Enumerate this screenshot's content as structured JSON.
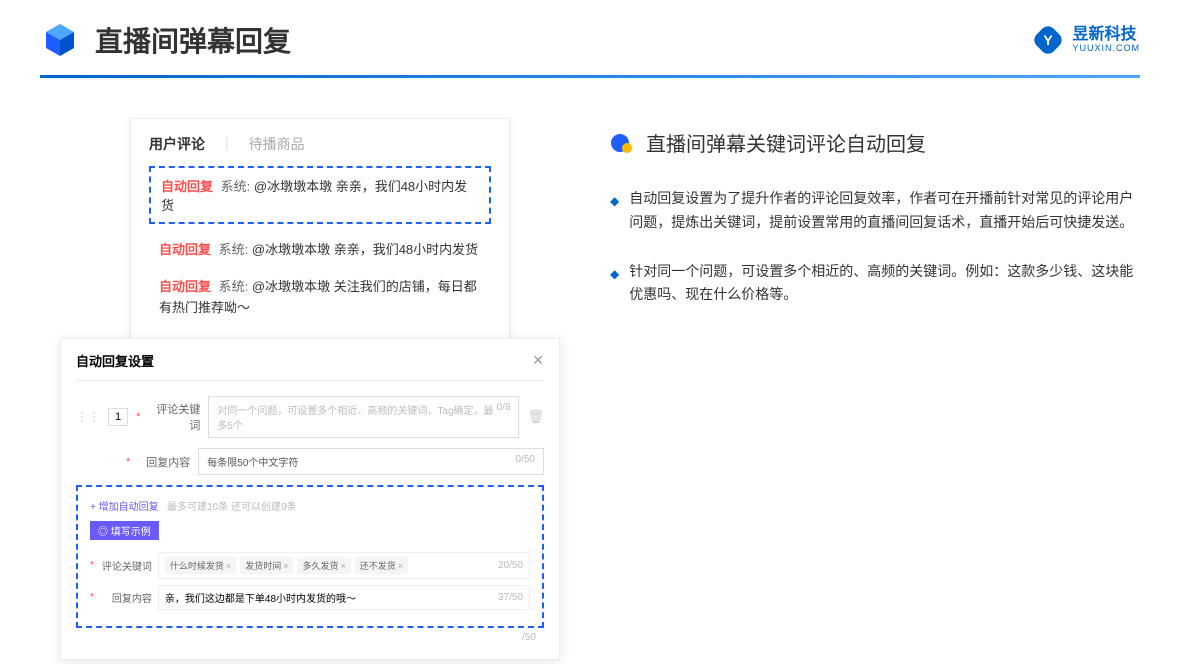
{
  "header": {
    "title": "直播间弹幕回复",
    "logo_cn": "昱新科技",
    "logo_en": "YUUXIN.COM"
  },
  "panel1": {
    "tab_active": "用户评论",
    "tab_inactive": "待播商品",
    "auto_reply_label": "自动回复",
    "sys_label": "系统:",
    "comment1": "@冰墩墩本墩 亲亲，我们48小时内发货",
    "comment2": "@冰墩墩本墩 亲亲，我们48小时内发货",
    "comment3": "@冰墩墩本墩 关注我们的店铺，每日都有热门推荐呦～"
  },
  "panel2": {
    "title": "自动回复设置",
    "row_num": "1",
    "label_keyword": "评论关键词",
    "placeholder_keyword": "对同一个问题，可设置多个相近、高频的关键词，Tag确定，最多5个",
    "counter_keyword": "0/8",
    "label_content": "回复内容",
    "placeholder_content": "每条限50个中文字符",
    "counter_content": "0/50",
    "add_link": "+ 增加自动回复",
    "add_hint": "最多可建10条 还可以创建9条",
    "example_badge": "◎ 填写示例",
    "ex_label_kw": "评论关键词",
    "ex_tags": [
      "什么时候发货",
      "发货时间",
      "多久发货",
      "还不发货"
    ],
    "ex_kw_counter": "20/50",
    "ex_label_content": "回复内容",
    "ex_content": "亲，我们这边都是下单48小时内发货的哦～",
    "ex_content_counter": "37/50",
    "outer_counter": "/50"
  },
  "right": {
    "section_title": "直播间弹幕关键词评论自动回复",
    "bullet1": "自动回复设置为了提升作者的评论回复效率，作者可在开播前针对常见的评论用户问题，提炼出关键词，提前设置常用的直播间回复话术，直播开始后可快捷发送。",
    "bullet2": "针对同一个问题，可设置多个相近的、高频的关键词。例如：这款多少钱、这块能优惠吗、现在什么价格等。"
  }
}
